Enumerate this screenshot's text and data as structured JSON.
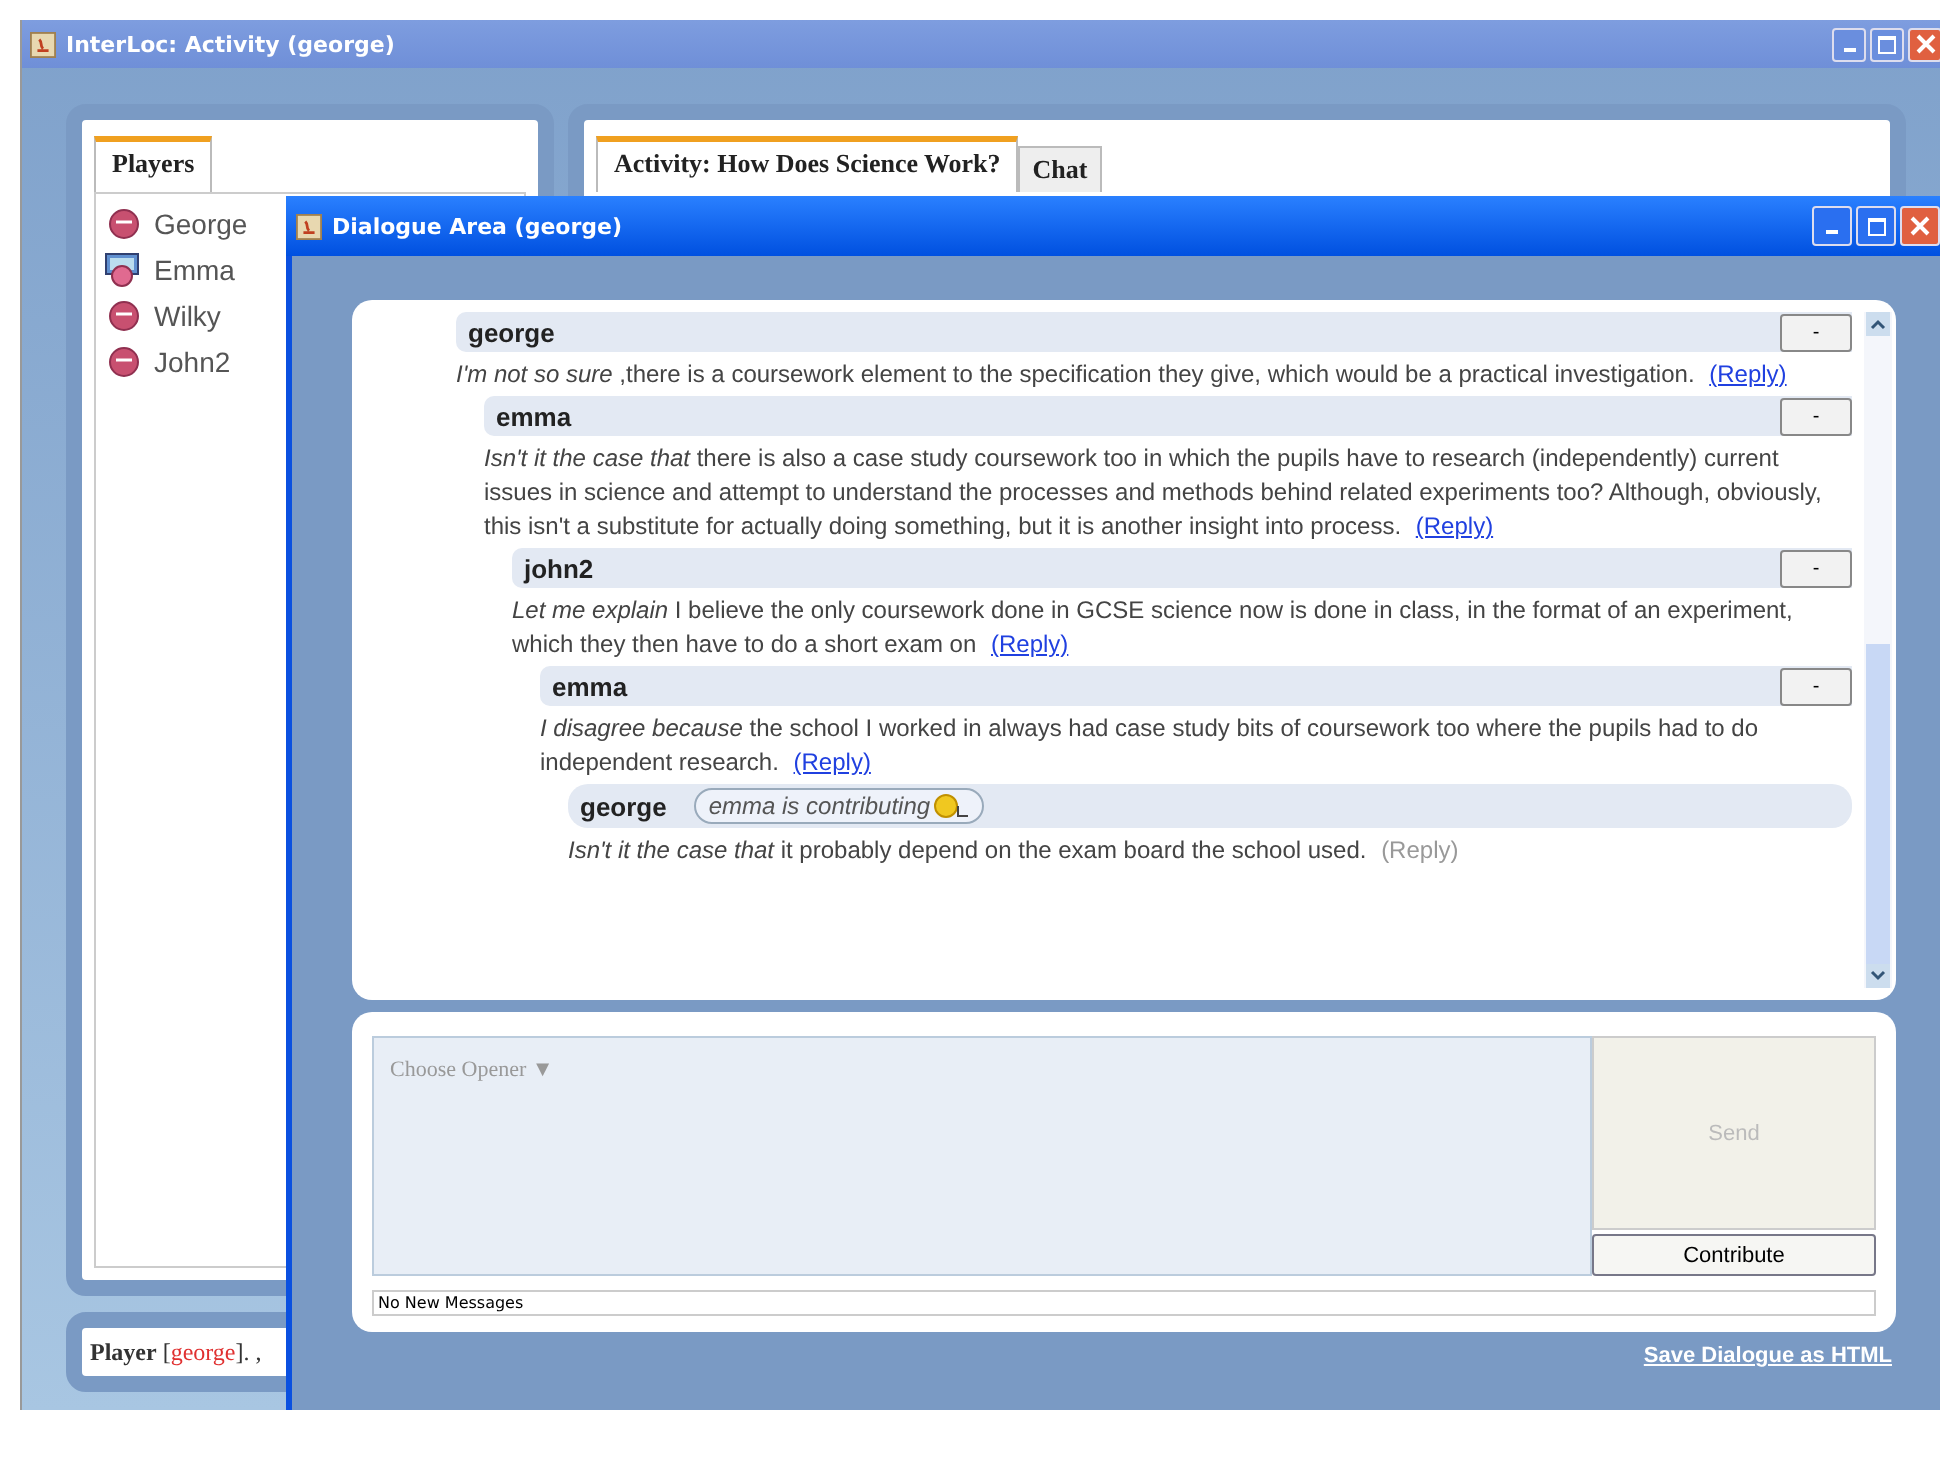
{
  "main_window": {
    "title": "InterLoc: Activity (george)"
  },
  "players_panel": {
    "tabs": [
      {
        "label": "Players",
        "selected": true
      }
    ],
    "players": [
      {
        "name": "George",
        "active": false
      },
      {
        "name": "Emma",
        "active": true
      },
      {
        "name": "Wilky",
        "active": false
      },
      {
        "name": "John2",
        "active": false
      }
    ]
  },
  "activity_panel": {
    "tabs": [
      {
        "label": "Activity: How Does Science Work?",
        "selected": true
      },
      {
        "label": "Chat",
        "selected": false
      }
    ]
  },
  "status": {
    "label": "Player",
    "open": "[",
    "name": "george",
    "close": "]. ,"
  },
  "dialogue_window": {
    "title": "Dialogue Area (george)",
    "messages": [
      {
        "author": "george",
        "collapse": "-",
        "body": "*I'm not so sure* ,there is a coursework element to the specification they give, which would be a practical investigation.",
        "reply": "(Reply)",
        "reply_enabled": true,
        "children": [
          {
            "author": "emma",
            "collapse": "-",
            "body": "*Isn't it the case that* there is also a case study coursework too in which the pupils have to research (independently) current issues in science and attempt to understand the processes and methods behind related experiments too? Although, obviously, this isn't a substitute for actually doing something, but it is another insight into process.",
            "reply": "(Reply)",
            "reply_enabled": true,
            "children": [
              {
                "author": "john2",
                "collapse": "-",
                "body": "*Let me explain* I believe the only coursework done in GCSE science now is done in class, in the format of an experiment, which they then have to do a short exam on",
                "reply": "(Reply)",
                "reply_enabled": true,
                "children": [
                  {
                    "author": "emma",
                    "collapse": "-",
                    "body": "*I disagree because* the school I worked in always had case study bits of coursework too where the pupils had to do independent research.",
                    "reply": "(Reply)",
                    "reply_enabled": true,
                    "children": [
                      {
                        "author": "george",
                        "typing": "emma is contributing",
                        "body": "*Isn't it the case that* it probably depend on the exam board the school used.",
                        "reply": "(Reply)",
                        "reply_enabled": false
                      }
                    ]
                  }
                ]
              }
            ]
          }
        ]
      }
    ],
    "opener": "Choose Opener ▼",
    "send": {
      "label": "Send",
      "disabled": true
    },
    "contribute": "Contribute",
    "message_status": "No New Messages",
    "save_link": "Save Dialogue as HTML"
  }
}
